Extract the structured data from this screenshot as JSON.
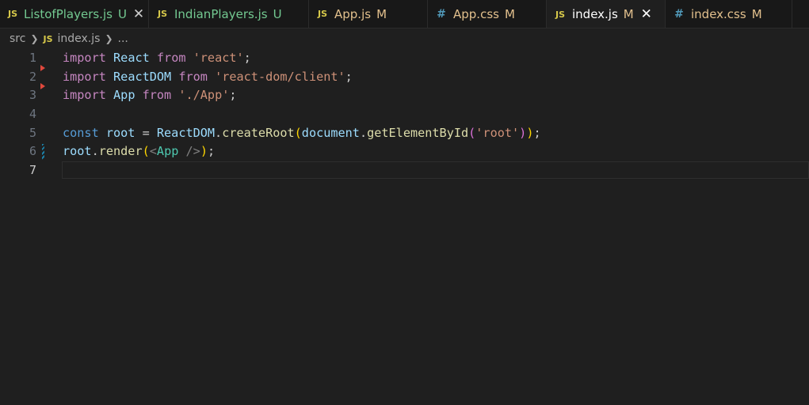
{
  "tabs": [
    {
      "icon": "JS",
      "icon_type": "js",
      "name": "ListofPlayers.js",
      "status": "U",
      "name_color": "green",
      "status_color": "green",
      "close": "✕",
      "active": false,
      "width": 188
    },
    {
      "icon": "JS",
      "icon_type": "js",
      "name": "IndianPlayers.js",
      "status": "U",
      "name_color": "green",
      "status_color": "green",
      "close": "",
      "active": false,
      "width": 202
    },
    {
      "icon": "JS",
      "icon_type": "js",
      "name": "App.js",
      "status": "M",
      "name_color": "gold",
      "status_color": "gold",
      "close": "",
      "active": false,
      "width": 150
    },
    {
      "icon": "#",
      "icon_type": "css",
      "name": "App.css",
      "status": "M",
      "name_color": "gold",
      "status_color": "gold",
      "close": "",
      "active": false,
      "width": 150
    },
    {
      "icon": "JS",
      "icon_type": "js",
      "name": "index.js",
      "status": "M",
      "name_color": "white",
      "status_color": "gold",
      "close": "✕",
      "active": true,
      "width": 150
    },
    {
      "icon": "#",
      "icon_type": "css",
      "name": "index.css",
      "status": "M",
      "name_color": "gold",
      "status_color": "gold",
      "close": "",
      "active": false,
      "width": 160
    }
  ],
  "breadcrumb": {
    "folder": "src",
    "file_icon": "JS",
    "file": "index.js",
    "more": "..."
  },
  "editor": {
    "current_line": 7,
    "lines": [
      {
        "number": "1",
        "tokens": [
          {
            "t": "import",
            "c": "kw"
          },
          {
            "t": " ",
            "c": "punc"
          },
          {
            "t": "React",
            "c": "id"
          },
          {
            "t": " ",
            "c": "punc"
          },
          {
            "t": "from",
            "c": "kw"
          },
          {
            "t": " ",
            "c": "punc"
          },
          {
            "t": "'react'",
            "c": "str"
          },
          {
            "t": ";",
            "c": "punc"
          }
        ]
      },
      {
        "number": "2",
        "marker": true,
        "tokens": [
          {
            "t": "import",
            "c": "kw"
          },
          {
            "t": " ",
            "c": "punc"
          },
          {
            "t": "ReactDOM",
            "c": "id"
          },
          {
            "t": " ",
            "c": "punc"
          },
          {
            "t": "from",
            "c": "kw"
          },
          {
            "t": " ",
            "c": "punc"
          },
          {
            "t": "'react-dom/client'",
            "c": "str"
          },
          {
            "t": ";",
            "c": "punc"
          }
        ]
      },
      {
        "number": "3",
        "marker": true,
        "tokens": [
          {
            "t": "import",
            "c": "kw"
          },
          {
            "t": " ",
            "c": "punc"
          },
          {
            "t": "App",
            "c": "id"
          },
          {
            "t": " ",
            "c": "punc"
          },
          {
            "t": "from",
            "c": "kw"
          },
          {
            "t": " ",
            "c": "punc"
          },
          {
            "t": "'./App'",
            "c": "str"
          },
          {
            "t": ";",
            "c": "punc"
          }
        ]
      },
      {
        "number": "4",
        "tokens": []
      },
      {
        "number": "5",
        "tokens": [
          {
            "t": "const",
            "c": "kw2"
          },
          {
            "t": " ",
            "c": "punc"
          },
          {
            "t": "root",
            "c": "id"
          },
          {
            "t": " = ",
            "c": "punc"
          },
          {
            "t": "ReactDOM",
            "c": "id"
          },
          {
            "t": ".",
            "c": "punc"
          },
          {
            "t": "createRoot",
            "c": "fn"
          },
          {
            "t": "(",
            "c": "br1"
          },
          {
            "t": "document",
            "c": "id"
          },
          {
            "t": ".",
            "c": "punc"
          },
          {
            "t": "getElementById",
            "c": "fn"
          },
          {
            "t": "(",
            "c": "br2"
          },
          {
            "t": "'root'",
            "c": "str"
          },
          {
            "t": ")",
            "c": "br2"
          },
          {
            "t": ")",
            "c": "br1"
          },
          {
            "t": ";",
            "c": "punc"
          }
        ]
      },
      {
        "number": "6",
        "modified": true,
        "tokens": [
          {
            "t": "root",
            "c": "id"
          },
          {
            "t": ".",
            "c": "punc"
          },
          {
            "t": "render",
            "c": "fn"
          },
          {
            "t": "(",
            "c": "br1"
          },
          {
            "t": "<",
            "c": "tag"
          },
          {
            "t": "App",
            "c": "comp"
          },
          {
            "t": " ",
            "c": "punc"
          },
          {
            "t": "/>",
            "c": "tag"
          },
          {
            "t": ")",
            "c": "br1"
          },
          {
            "t": ";",
            "c": "punc"
          }
        ]
      },
      {
        "number": "7",
        "tokens": []
      }
    ]
  }
}
